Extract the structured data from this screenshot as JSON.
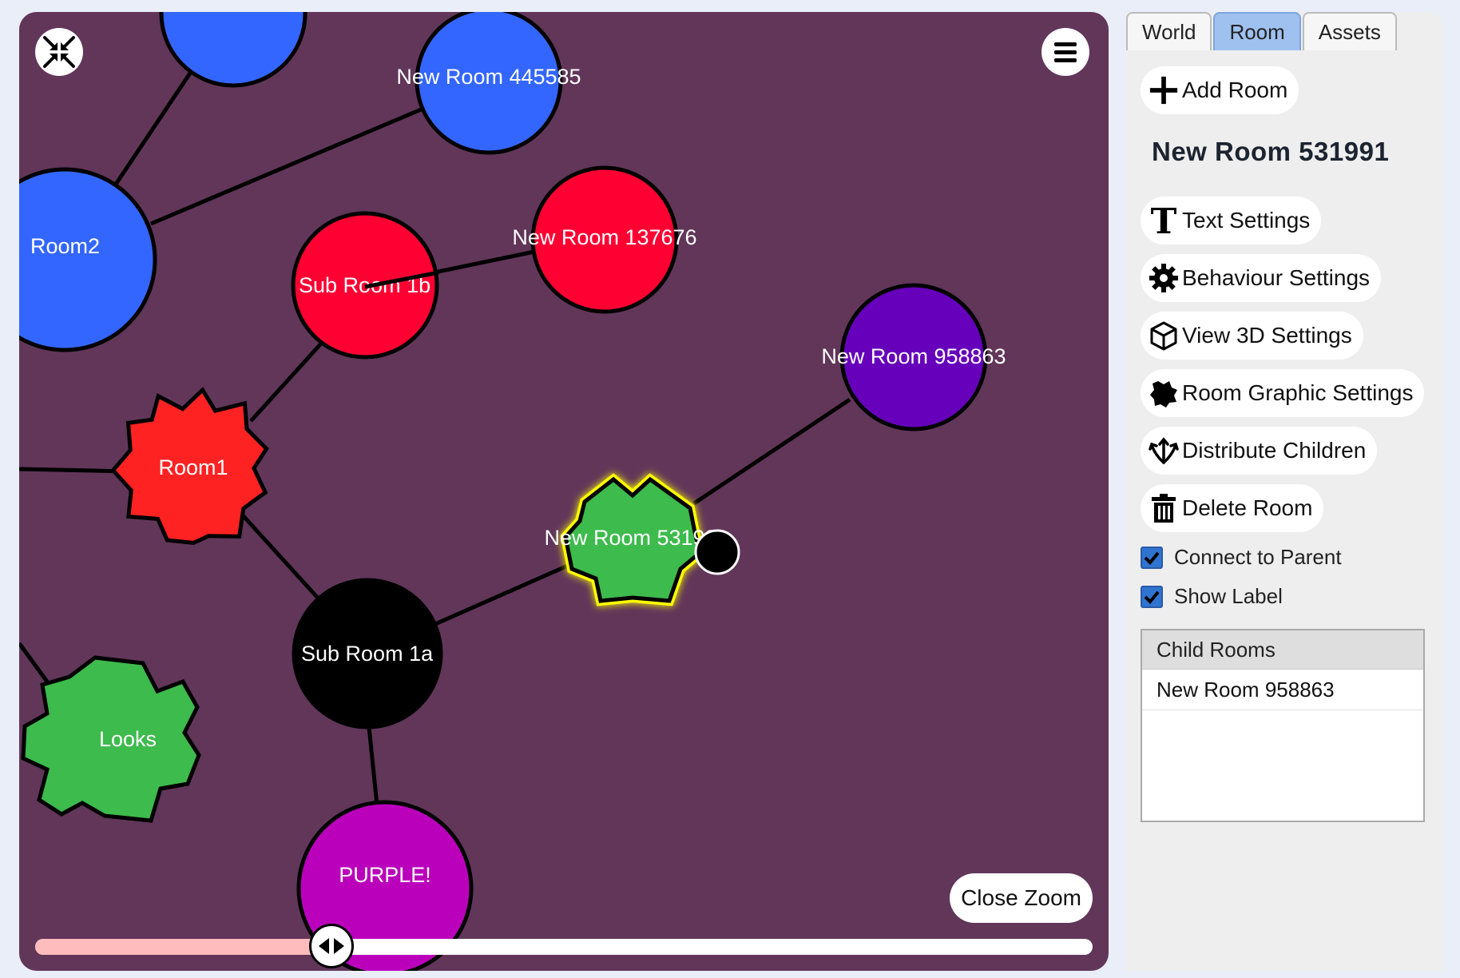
{
  "canvas": {
    "background": "#613659",
    "collapse_icon": "collapse-arrows-icon",
    "menu_icon": "hamburger-menu-icon",
    "rooms": [
      {
        "id": "top-blue",
        "label": "",
        "shape": "circle",
        "color": "#3366ff"
      },
      {
        "id": "room-445585",
        "label": "New Room 445585",
        "shape": "circle",
        "color": "#3366ff"
      },
      {
        "id": "room2",
        "label": "Room2",
        "shape": "circle",
        "color": "#3366ff"
      },
      {
        "id": "sub-room-1b",
        "label": "Sub Room 1b",
        "shape": "circle",
        "color": "#ff0033"
      },
      {
        "id": "room-137676",
        "label": "New Room 137676",
        "shape": "circle",
        "color": "#ff0033"
      },
      {
        "id": "room-958863",
        "label": "New Room 958863",
        "shape": "circle",
        "color": "#6600bb"
      },
      {
        "id": "room1",
        "label": "Room1",
        "shape": "gear",
        "color": "#ff2222"
      },
      {
        "id": "room-531991",
        "label": "New Room 531991",
        "shape": "gear",
        "color": "#3dbb4c",
        "selected": true
      },
      {
        "id": "sub-room-1a",
        "label": "Sub Room 1a",
        "shape": "circle",
        "color": "#000000"
      },
      {
        "id": "looks",
        "label": "Looks",
        "shape": "gear",
        "color": "#3dbb4c"
      },
      {
        "id": "purple",
        "label": "PURPLE!",
        "shape": "circle",
        "color": "#bb00bb"
      }
    ],
    "connections": [
      [
        "top-blue",
        "room2"
      ],
      [
        "room-445585",
        "room2"
      ],
      [
        "sub-room-1b",
        "room-137676"
      ],
      [
        "sub-room-1b",
        "room1"
      ],
      [
        "room1",
        "sub-room-1a"
      ],
      [
        "sub-room-1a",
        "room-531991"
      ],
      [
        "room-531991",
        "room-958863"
      ],
      [
        "sub-room-1a",
        "purple"
      ]
    ],
    "close_zoom_label": "Close Zoom",
    "zoom_level": 0.28,
    "zoom_handle_icon": "left-right-arrows-icon"
  },
  "sidebar": {
    "tabs": [
      {
        "label": "World",
        "active": false
      },
      {
        "label": "Room",
        "active": true
      },
      {
        "label": "Assets",
        "active": false
      }
    ],
    "add_room_label": "Add Room",
    "room_title": "New Room 531991",
    "actions": [
      {
        "label": "Text Settings",
        "icon": "text-t-icon"
      },
      {
        "label": "Behaviour Settings",
        "icon": "gear-icon"
      },
      {
        "label": "View 3D Settings",
        "icon": "cube-icon"
      },
      {
        "label": "Room Graphic Settings",
        "icon": "gear-shape-icon"
      },
      {
        "label": "Distribute Children",
        "icon": "distribute-icon"
      },
      {
        "label": "Delete Room",
        "icon": "trash-icon"
      }
    ],
    "checkboxes": [
      {
        "label": "Connect to Parent",
        "checked": true
      },
      {
        "label": "Show Label",
        "checked": true
      }
    ],
    "child_rooms": {
      "header": "Child Rooms",
      "items": [
        "New Room 958863"
      ]
    }
  },
  "colors": {
    "tab_active": "#9fc1f0",
    "checkbox": "#2f74d0",
    "selection_glow": "#ffff00",
    "zoom_fill": "#ffbcbc"
  }
}
